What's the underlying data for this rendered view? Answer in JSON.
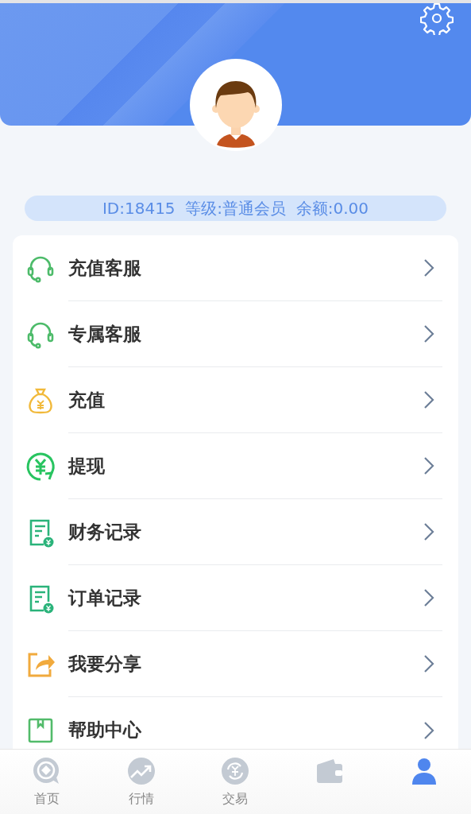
{
  "profile": {
    "info": "ID:18415  等级:普通会员  余额:0.00"
  },
  "menu": [
    {
      "kind": "headset",
      "label": "充值客服"
    },
    {
      "kind": "headset",
      "label": "专属客服"
    },
    {
      "kind": "moneybag",
      "label": "充值"
    },
    {
      "kind": "yuan",
      "label": "提现"
    },
    {
      "kind": "record",
      "label": "财务记录"
    },
    {
      "kind": "record",
      "label": "订单记录"
    },
    {
      "kind": "share",
      "label": "我要分享"
    },
    {
      "kind": "book",
      "label": "帮助中心"
    }
  ],
  "tab_bar": [
    {
      "kind": "home",
      "label": "首页",
      "selected": false
    },
    {
      "kind": "chart",
      "label": "行情",
      "selected": false
    },
    {
      "kind": "exchange",
      "label": "交易",
      "selected": false
    },
    {
      "kind": "wallet",
      "selected": false
    },
    {
      "kind": "user",
      "selected": true
    }
  ]
}
